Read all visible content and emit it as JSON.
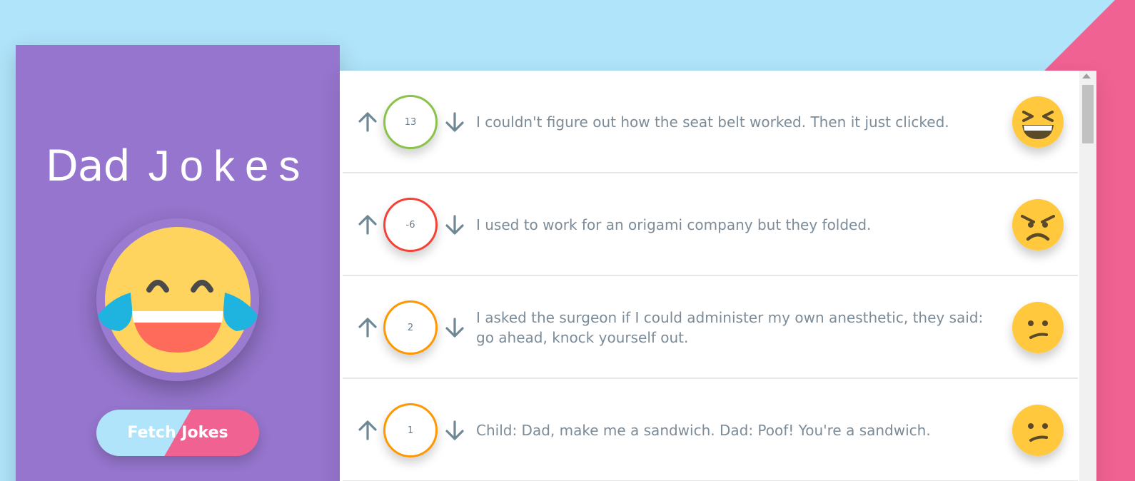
{
  "sidebar": {
    "title_bold": "Dad",
    "title_light": "Jokes",
    "hero_icon": "laughing-tears-emoji",
    "button_label": "Fetch Jokes"
  },
  "colors": {
    "background_light": "#b0e4fa",
    "background_accent": "#f06292",
    "sidebar": "#9575cd",
    "text": "#7b8b98"
  },
  "jokes": [
    {
      "score": "13",
      "text": "I couldn't figure out how the seat belt worked. Then it just clicked.",
      "score_color": "#8bc34a",
      "reaction": "grinning-squinting-emoji"
    },
    {
      "score": "-6",
      "text": "I used to work for an origami company but they folded.",
      "score_color": "#f44336",
      "reaction": "angry-face-emoji"
    },
    {
      "score": "2",
      "text": "I asked the surgeon if I could administer my own anesthetic, they said: go ahead, knock yourself out.",
      "score_color": "#ff9800",
      "reaction": "confused-face-emoji"
    },
    {
      "score": "1",
      "text": "Child: Dad, make me a sandwich. Dad: Poof! You're a sandwich.",
      "score_color": "#ff9800",
      "reaction": "confused-face-emoji"
    }
  ]
}
